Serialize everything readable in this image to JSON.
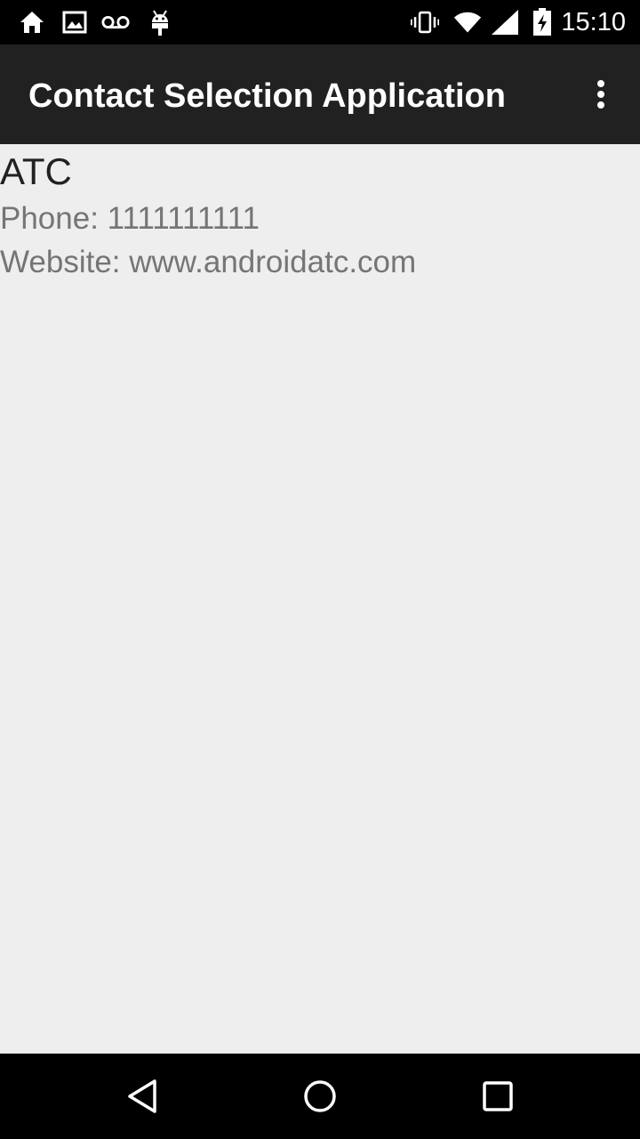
{
  "status_bar": {
    "time": "15:10",
    "left_icons": [
      "home-icon",
      "image-icon",
      "voicemail-icon",
      "android-icon"
    ],
    "right_icons": [
      "vibrate-icon",
      "wifi-icon",
      "cell-signal-icon",
      "battery-charging-icon"
    ]
  },
  "app_bar": {
    "title": "Contact Selection Application",
    "menu_icon": "more-vert-icon"
  },
  "contact": {
    "name": "ATC",
    "phone": "Phone: 1111111111",
    "website": "Website: www.androidatc.com"
  },
  "nav_bar": {
    "icons": [
      "back-icon",
      "home-circle-icon",
      "recents-icon"
    ]
  },
  "colors": {
    "status_bar_bg": "#000000",
    "app_bar_bg": "#212121",
    "content_bg": "#eeeeee",
    "primary_text": "#212121",
    "secondary_text": "#757575"
  }
}
